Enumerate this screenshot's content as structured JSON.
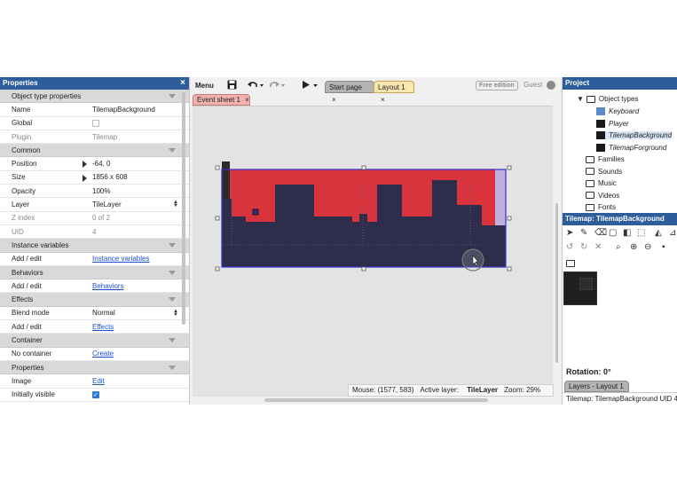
{
  "properties": {
    "title": "Properties",
    "close": "×",
    "rows": [
      {
        "type": "section",
        "label": "Object type properties"
      },
      {
        "type": "row",
        "key": "Name",
        "value": "TilemapBackground"
      },
      {
        "type": "check",
        "key": "Global",
        "checked": false
      },
      {
        "type": "row",
        "key": "Plugin",
        "value": "Tilemap",
        "dim": true
      },
      {
        "type": "section",
        "label": "Common"
      },
      {
        "type": "row",
        "key": "Position",
        "value": "-64, 0",
        "expand": true
      },
      {
        "type": "row",
        "key": "Size",
        "value": "1856 x 608",
        "expand": true
      },
      {
        "type": "row",
        "key": "Opacity",
        "value": "100%"
      },
      {
        "type": "select",
        "key": "Layer",
        "value": "TileLayer"
      },
      {
        "type": "row",
        "key": "Z index",
        "value": "0 of 2",
        "dim": true
      },
      {
        "type": "row",
        "key": "UID",
        "value": "4",
        "dim": true
      },
      {
        "type": "section",
        "label": "Instance variables"
      },
      {
        "type": "link",
        "key": "Add / edit",
        "value": "Instance variables"
      },
      {
        "type": "section",
        "label": "Behaviors"
      },
      {
        "type": "link",
        "key": "Add / edit",
        "value": "Behaviors"
      },
      {
        "type": "section",
        "label": "Effects"
      },
      {
        "type": "select",
        "key": "Blend mode",
        "value": "Normal"
      },
      {
        "type": "link",
        "key": "Add / edit",
        "value": "Effects"
      },
      {
        "type": "section",
        "label": "Container"
      },
      {
        "type": "link",
        "key": "No container",
        "value": "Create"
      },
      {
        "type": "section",
        "label": "Properties"
      },
      {
        "type": "link",
        "key": "Image",
        "value": "Edit"
      },
      {
        "type": "check",
        "key": "Initially visible",
        "checked": true
      }
    ]
  },
  "toolbar": {
    "menu_label": "Menu",
    "tabs": {
      "start": "Start page",
      "layout": "Layout 1",
      "close": "×"
    },
    "edition": "Free edition",
    "user": "Guest"
  },
  "event_tab": {
    "label": "Event sheet 1",
    "close": "×"
  },
  "statusbar": {
    "mouse": "Mouse: (1577, 583)",
    "active_layer_label": "Active layer:",
    "active_layer": "TileLayer",
    "zoom": "Zoom: 29%"
  },
  "project": {
    "title": "Project",
    "object_types": "Object types",
    "objects": [
      "Keyboard",
      "Player",
      "TilemapBackground",
      "TilemapForground"
    ],
    "folders": [
      "Families",
      "Sounds",
      "Music",
      "Videos",
      "Fonts"
    ]
  },
  "tilemap": {
    "title": "Tilemap: TilemapBackground UI...",
    "rotation": "Rotation: 0°",
    "layers_tab": "Layers - Layout 1",
    "footer": "Tilemap: TilemapBackground UID 4"
  },
  "colors": {
    "panel_title": "#2d5e9b",
    "sky_red": "#d9343e",
    "terrain": "#2e2e4c",
    "selection": "#3333cc"
  }
}
